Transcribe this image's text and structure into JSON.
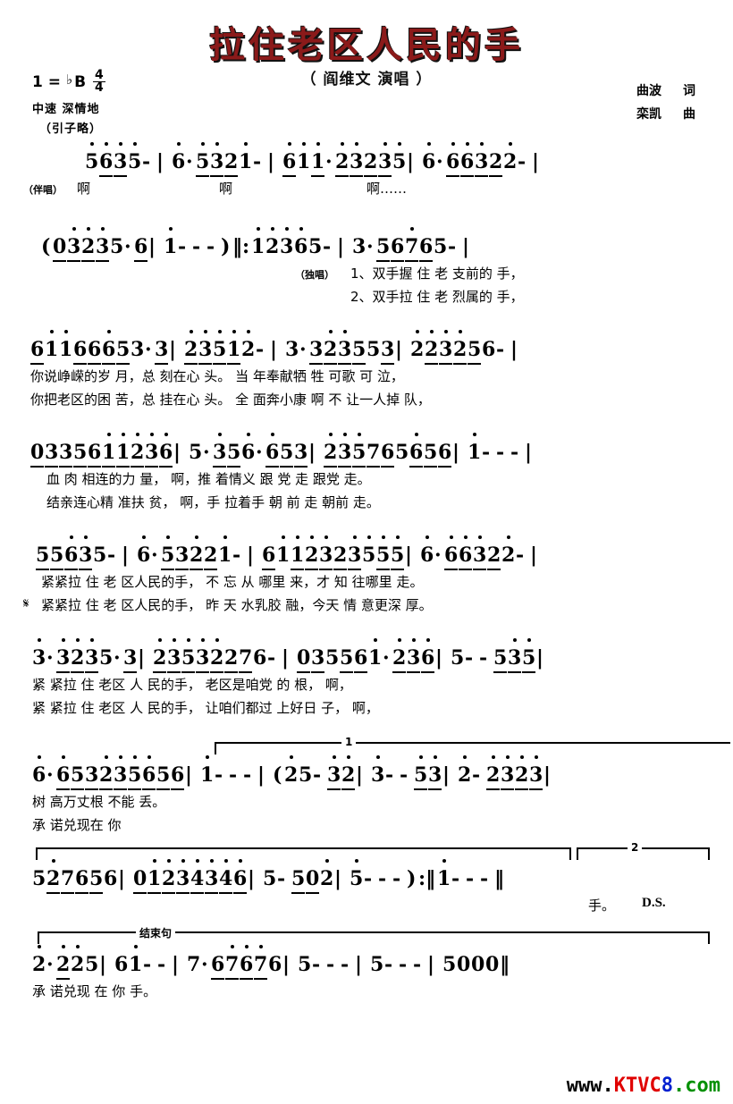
{
  "header": {
    "title": "拉住老区人民的手",
    "singer": "（ 阎维文 演唱 ）",
    "key_label": "1 =",
    "key_flat": "♭",
    "key_note": "B",
    "time_num": "4",
    "time_den": "4",
    "tempo": "中速 深情地",
    "prelude": "（引子略）",
    "lyricist_name": "曲波",
    "lyricist_role": "词",
    "composer_name": "栾凯",
    "composer_role": "曲",
    "title_color": "#8b1a1a"
  },
  "systems": [
    {
      "id": "system-1",
      "prefix": "（伴唱）",
      "notes": "5 6 3 5 - | 6 · 5 3 2 1 - | 6 1 1 · 2 3 2 3 5 | 6 · 6 6 3 2 2 - |",
      "lyrics_1": "啊          啊          啊……",
      "lyrics_2": ""
    },
    {
      "id": "system-2",
      "prefix": "（独唱）",
      "notes": "( 0 3 2 3 5 · 6 | 1 - - - ) ‖: 1 2 3 6 5 - | 3 · 5 6 7 6 5 - |",
      "lyrics_1": "1、双手握  住   老  支前的  手，",
      "lyrics_2": "2、双手拉  住   老  烈属的  手，"
    },
    {
      "id": "system-3",
      "prefix": "",
      "notes": "6 1 1 6 6 6 5 3 · 3 | 2 3 5 1 2 - | 3 · 3 2 3 5  5  3 | 2 2 3 2 5 6 - |",
      "lyrics_1": "你说峥嵘的岁 月，总 刻在心 头。  当 年奉献牺 牲    可歌 可 泣，",
      "lyrics_2": "你把老区的困 苦，总 挂在心 头。  全 面奔小康 啊 不  让一人掉 队，"
    },
    {
      "id": "system-4",
      "prefix": "",
      "notes": "0 3 3 5 6 1 1 2 3 6 | 5 · 3 5 6 · 6 5 3 | 2 3 5 7 6 5 6 5 6 | 1 - - - |",
      "lyrics_1": "血 肉 相连的力  量， 啊，推 着情义  跟  党 走 跟党  走。",
      "lyrics_2": "结亲连心精 准扶 贫， 啊，手 拉着手  朝  前 走 朝前  走。"
    },
    {
      "id": "system-5",
      "prefix": "𝄋",
      "notes": "5 5 6 3 5 - | 6 · 5 3 2 2 1 - | 6 1 1 2 3 2 3 5 5 5 | 6 · 6 6 3 2 2 - |",
      "lyrics_1": "紧紧拉 住 老 区人民的手， 不 忘 从 哪里 来，才  知 往哪里 走。",
      "lyrics_2": "紧紧拉 住 老 区人民的手， 昨 天 水乳胶  融，今天 情 意更深 厚。"
    },
    {
      "id": "system-6",
      "prefix": "",
      "notes": "3 · 3 2 3 5 · 3 | 2 3 5 3 2 2 7 6 - | 0 3 5 5 6 1 · 2 3 6 | 5 - - 5 3 5 |",
      "lyrics_1": "紧 紧拉 住  老区 人 民的手，  老区是咱党  的  根，  啊，",
      "lyrics_2": "紧 紧拉 住  老区 人 民的手，  让咱们都过 上好日 子，  啊，"
    },
    {
      "id": "system-7",
      "prefix": "",
      "ending": "1",
      "notes": "6 · 6 5 3 2 3 5 6 5 6 | 1 - - - | ( 2 5 - 3 2 | 3 - - 5 3 | 2 - 2 3 2 3 |",
      "lyrics_1": "树 高万丈根  不能  丢。",
      "lyrics_2": "承 诺兑现在  你"
    },
    {
      "id": "system-8",
      "prefix": "",
      "ending": "2",
      "notes": "5 2 7 6 5 6 | 0 1 2 3 4 3 4 6 | 5 - 5 0 2 | 5 - - - ) :‖ 1 - - - ‖",
      "lyrics_1": "手。      D.S.",
      "lyrics_2": ""
    },
    {
      "id": "system-9",
      "bracket_label": "结束句",
      "notes": "2 · 2 2 5 | 6 1 - - | 7 · 6 7 6 7 6 | 5 - - - | 5 - - - | 5 0 0 0 ‖",
      "lyrics_1": "承 诺兑现 在    你     手。",
      "lyrics_2": ""
    }
  ],
  "watermark": {
    "part1": "www.",
    "part2": "KTVC",
    "part3": "8",
    "part4": ".com"
  }
}
